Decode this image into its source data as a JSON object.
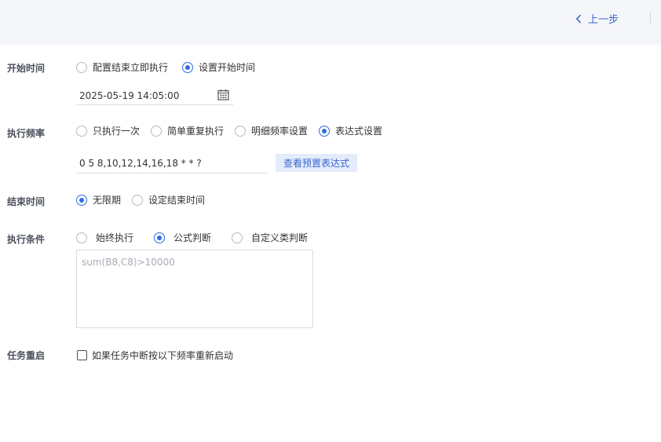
{
  "header": {
    "back_label": "上一步"
  },
  "start_time": {
    "label": "开始时间",
    "options": [
      {
        "label": "配置结束立即执行",
        "selected": false
      },
      {
        "label": "设置开始时间",
        "selected": true
      }
    ],
    "datetime_value": "2025-05-19 14:05:00"
  },
  "frequency": {
    "label": "执行频率",
    "options": [
      {
        "label": "只执行一次",
        "selected": false
      },
      {
        "label": "简单重复执行",
        "selected": false
      },
      {
        "label": "明细频率设置",
        "selected": false
      },
      {
        "label": "表达式设置",
        "selected": true
      }
    ],
    "expression_value": "0 5 8,10,12,14,16,18 * * ?",
    "preset_button": "查看预置表达式"
  },
  "end_time": {
    "label": "结束时间",
    "options": [
      {
        "label": "无限期",
        "selected": true
      },
      {
        "label": "设定结束时间",
        "selected": false
      }
    ]
  },
  "condition": {
    "label": "执行条件",
    "options": [
      {
        "label": "始终执行",
        "selected": false
      },
      {
        "label": "公式判断",
        "selected": true
      },
      {
        "label": "自定义类判断",
        "selected": false
      }
    ],
    "formula_placeholder": "sum(B8,C8)>10000"
  },
  "restart": {
    "label": "任务重启",
    "checkbox_label": "如果任务中断按以下频率重新启动",
    "checked": false
  },
  "colors": {
    "accent": "#2f6be5",
    "link": "#3a66d1",
    "topbar": "#f5f6fa",
    "button_bg": "#e4ecfb"
  },
  "icons": {
    "back": "chevron-left-icon",
    "calendar": "calendar-icon"
  }
}
